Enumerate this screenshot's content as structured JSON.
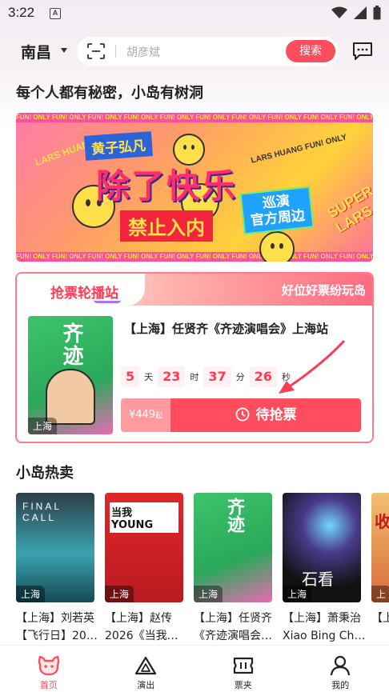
{
  "status_bar": {
    "time": "3:22",
    "sim_label": "A"
  },
  "header": {
    "city": "南昌",
    "search_placeholder": "胡彦斌",
    "search_button": "搜索"
  },
  "slogan": "每个人都有秘密，小岛有树洞",
  "banner": {
    "stripe_text": "FUN! ONLY FUN! ONLY FUN! ONLY FUN! ONLY FUN! ONLY FUN! ONLY FUN! ONLY FUN! ONLY FUN! ONLY FUN! ONLY",
    "artist_tag": "黄子弘凡",
    "headline": "除了快乐",
    "sub_tag": "禁止入内",
    "tour_tag": "巡演\n官方周边",
    "lars_left": "LARS HUANG",
    "lars_right": "LARS HUANG FUN! ONLY",
    "super_text": "SUPER LARS"
  },
  "ticket_carousel": {
    "title": "抢票轮播站",
    "slogan": "好位好票纷玩岛",
    "poster_city": "上海",
    "poster_text": "齐迹",
    "event_name": "【上海】任贤齐《齐迹演唱会》上海站",
    "countdown": {
      "days": "5",
      "days_unit": "天",
      "hours": "23",
      "hours_unit": "时",
      "minutes": "37",
      "minutes_unit": "分",
      "seconds": "26",
      "seconds_unit": "秒"
    },
    "price": "¥449",
    "price_suffix": "起",
    "buy_label": "待抢票"
  },
  "hot": {
    "title": "小岛热卖",
    "items": [
      {
        "city": "上海",
        "line1": "【上海】刘若英",
        "line2": "【飞行日】20…",
        "poster_text": "FINAL CALL",
        "bg": "#2e8f9c"
      },
      {
        "city": "上海",
        "line1": "【上海】赵传",
        "line2": "2026《当我…",
        "poster_text": "当我 YOUNG",
        "bg": "#d9252b"
      },
      {
        "city": "上海",
        "line1": "【上海】任贤齐",
        "line2": "《齐迹演唱会…",
        "poster_text": "齐迹",
        "bg": "#3cc46a"
      },
      {
        "city": "上海",
        "line1": "【上海】萧秉治",
        "line2": "Xiao Bing Chi…",
        "poster_text": "石看",
        "bg": "#1b1b2a"
      },
      {
        "city": "上",
        "line1": "【上",
        "line2": "",
        "poster_text": "收",
        "bg": "#e8a14a"
      }
    ]
  },
  "tabbar": {
    "items": [
      {
        "label": "首页",
        "active": true
      },
      {
        "label": "演出",
        "active": false
      },
      {
        "label": "票夹",
        "active": false
      },
      {
        "label": "我的",
        "active": false
      }
    ]
  },
  "colors": {
    "accent": "#ff4d5e",
    "accent_light": "#ff9aa0"
  }
}
